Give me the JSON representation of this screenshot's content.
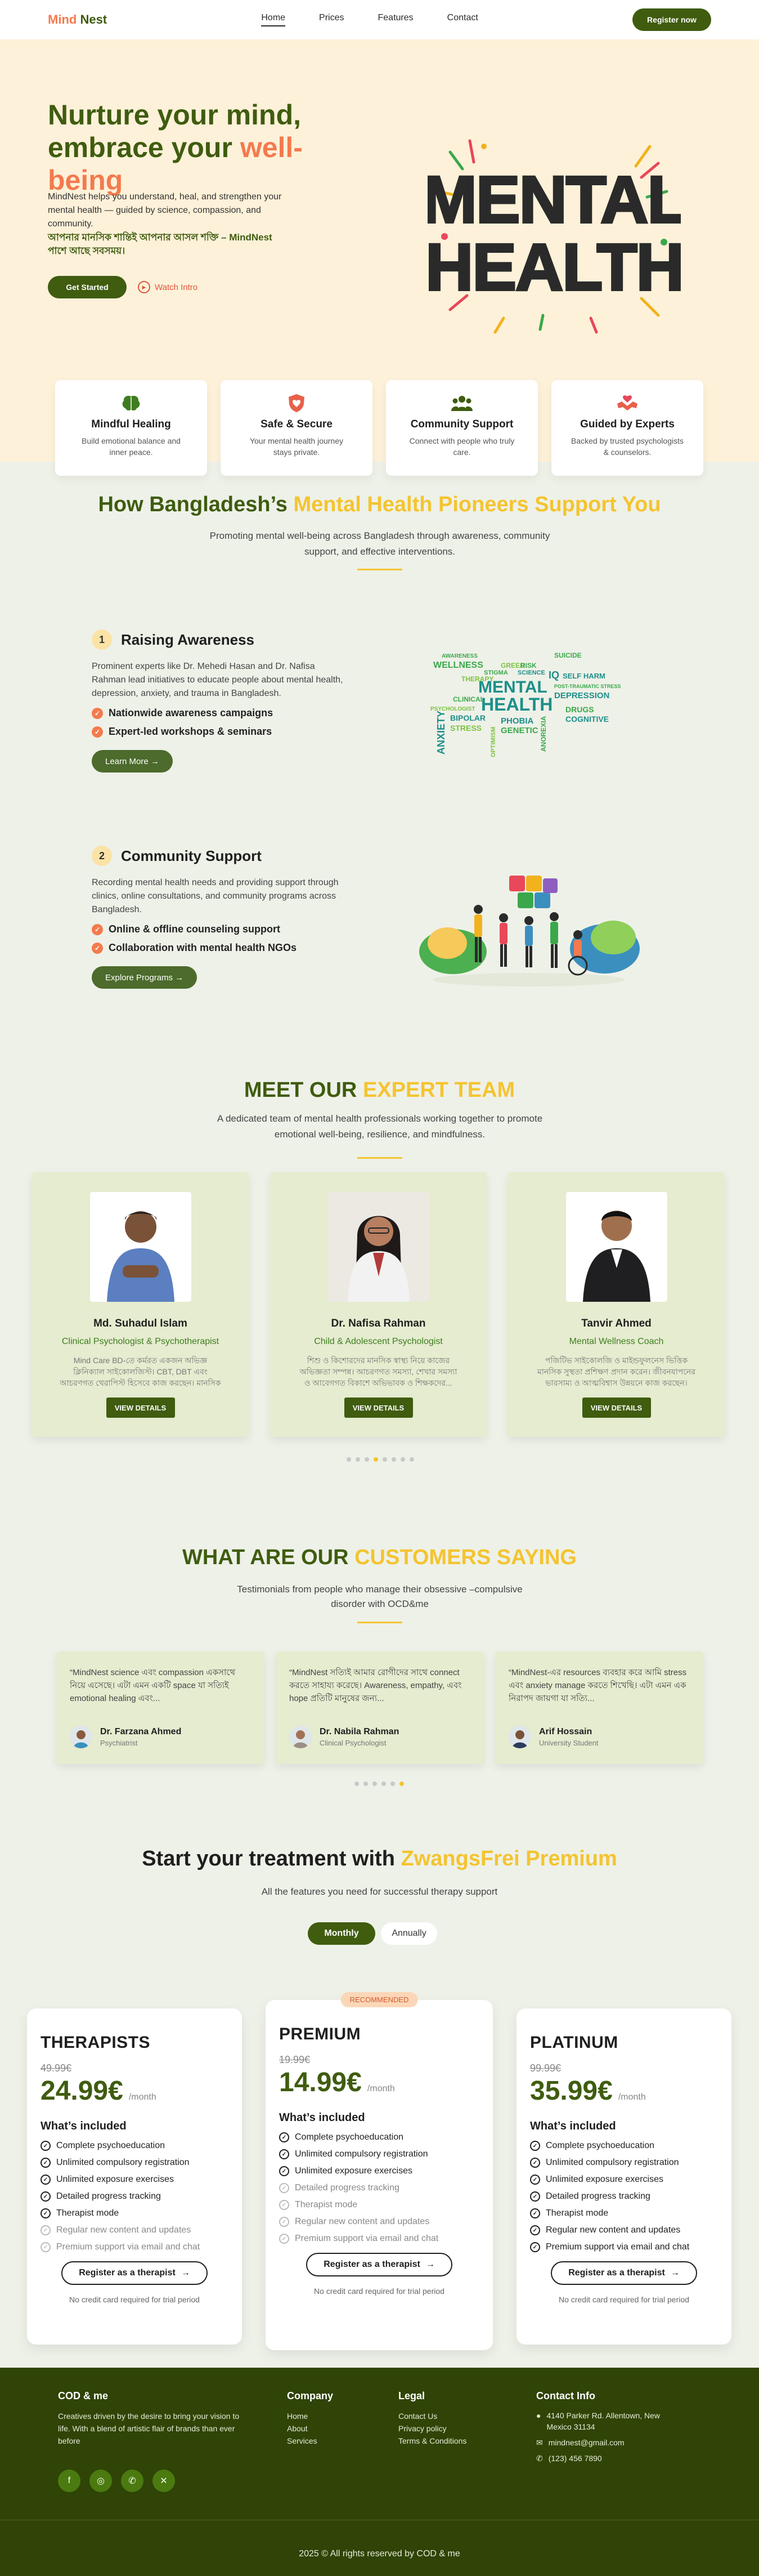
{
  "nav": {
    "brand_part1": "Mind",
    "brand_part2": "Nest",
    "links": [
      "Home",
      "Prices",
      "Features",
      "Contact"
    ],
    "register": "Register now"
  },
  "hero": {
    "title_line1": "Nurture your mind,",
    "title_line2": "embrace your",
    "title_accent1": "well-",
    "title_accent2": "being",
    "desc": "MindNest helps you understand, heal, and strengthen your mental health — guided by science, compassion, and community.",
    "bangla": "আপনার মানসিক শান্তিই আপনার আসল শক্তি – MindNest পাশে আছে সবসময়।",
    "start": "Get Started",
    "intro": "Watch Intro",
    "art_line1": "MENTAL",
    "art_line2": "HEALTH"
  },
  "features": [
    {
      "title": "Mindful Healing",
      "desc": "Build emotional balance and inner peace.",
      "icon": "brain-icon"
    },
    {
      "title": "Safe & Secure",
      "desc": "Your mental health journey stays private.",
      "icon": "shield-heart-icon"
    },
    {
      "title": "Community Support",
      "desc": "Connect with people who truly care.",
      "icon": "people-icon"
    },
    {
      "title": "Guided by Experts",
      "desc": "Backed by trusted psychologists & counselors.",
      "icon": "handshake-heart-icon"
    }
  ],
  "pioneers": {
    "title": "How Bangladesh’s",
    "title_accent": "Mental Health Pioneers Support You",
    "subtitle": "Promoting mental well-being across Bangladesh through awareness, community support, and effective interventions.",
    "step1": {
      "num": "1",
      "title": "Raising Awareness",
      "desc": "Prominent experts like Dr. Mehedi Hasan and Dr. Nafisa Rahman lead initiatives to educate people about mental health, depression, anxiety, and trauma in Bangladesh.",
      "bullets": [
        "Nationwide awareness campaigns",
        "Expert-led workshops & seminars"
      ],
      "button": "Learn More →"
    },
    "step2": {
      "num": "2",
      "title": "Community Support",
      "desc": "Recording mental health needs and providing support through clinics, online consultations, and community programs across Bangladesh.",
      "bullets": [
        "Online & offline counseling support",
        "Collaboration with mental health NGOs"
      ],
      "button": "Explore Programs →"
    },
    "wordcloud": [
      "AWARENESS",
      "WELLNESS",
      "ANXIETY",
      "MENTAL",
      "HEALTH",
      "THERAPY",
      "DEPRESSION",
      "SUICIDE",
      "BIPOLAR",
      "STRESS",
      "PHOBIA",
      "GENETIC",
      "DRUGS",
      "COGNITIVE",
      "PSYCHOLOGIST",
      "SELF HARM",
      "POST-TRAUMATIC STRESS",
      "CLINICAL",
      "IQ",
      "ANOREXIA",
      "GREED",
      "RISK",
      "STIGMA",
      "SCIENCE",
      "OPTIMISM"
    ]
  },
  "team": {
    "title": "MEET OUR",
    "title_accent": "EXPERT TEAM",
    "subtitle": "A dedicated team of mental health professionals working together to promote emotional well-being, resilience, and mindfulness.",
    "members": [
      {
        "name": "Md. Suhadul Islam",
        "role": "Clinical Psychologist & Psychotherapist",
        "bio": "Mind Care BD-তে কর্মরত একজন অভিজ্ঞ ক্লিনিক্যাল সাইকোলজিস্ট। CBT, DBT এবং আচরণগত থেরাপিস্ট হিসেবে কাজ করছেন। মানসিক চিকিৎসা ও আত্মবিশ্বাস...",
        "button": "VIEW DETAILS",
        "shirt": "#5b7fc0"
      },
      {
        "name": "Dr. Nafisa Rahman",
        "role": "Child & Adolescent Psychologist",
        "bio": "শিশু ও কিশোরদের মানসিক স্বাস্থ্য নিয়ে কাজের অভিজ্ঞতা সম্পন্ন। আচরণগত সমস্যা, শেখার সমস্যা ও আবেগগত বিকাশে অভিভাবক ও শিক্ষকদের...",
        "button": "VIEW DETAILS",
        "shirt": "#f2f2f2"
      },
      {
        "name": "Tanvir Ahmed",
        "role": "Mental Wellness Coach",
        "bio": "পজিটিভ সাইকোলজি ও মাইন্ডফুলনেস ভিত্তিক মানসিক সুস্থতা প্রশিক্ষণ প্রদান করেন। জীবনযাপনের ভারসাম্য ও আত্মবিশ্বাস উন্নয়নে কাজ করছেন।",
        "button": "VIEW DETAILS",
        "shirt": "#1f1f22"
      }
    ],
    "dots_total": 8,
    "dots_active": 3
  },
  "testimonials": {
    "title": "WHAT ARE OUR",
    "title_accent": "CUSTOMERS SAYING",
    "subtitle": "Testimonials from people who manage their obsessive –compulsive disorder with OCD&me",
    "items": [
      {
        "quote": "“MindNest science এবং compassion একসাথে নিয়ে এসেছে। এটা এমন একটি space যা সত্যিই emotional healing এবং...",
        "name": "Dr. Farzana Ahmed",
        "role": "Psychiatrist"
      },
      {
        "quote": "“MindNest সত্যিই আমার রোগীদের সাথে connect করতে সাহায্য করেছে। Awareness, empathy, এবং hope প্রতিটি মানুষের জন্য...",
        "name": "Dr. Nabila Rahman",
        "role": "Clinical Psychologist"
      },
      {
        "quote": "“MindNest-এর resources ব্যবহার করে আমি stress এবং anxiety manage করতে শিখেছি। এটা এমন এক নিরাপদ জায়গা যা সত্যি...",
        "name": "Arif Hossain",
        "role": "University Student"
      }
    ],
    "dots_total": 6,
    "dots_active": 5
  },
  "pricing": {
    "title": "Start your treatment with",
    "title_accent": "ZwangsFrei Premium",
    "subtitle": "All the features you need for successful therapy support",
    "toggle_on": "Monthly",
    "toggle_off": "Annually",
    "recommended": "RECOMMENDED",
    "per": "/month",
    "included": "What’s included",
    "note": "No credit card required for trial period",
    "plans": [
      {
        "name": "THERAPISTS",
        "old": "49.99€",
        "price": "24.99€",
        "cta": "Register as a therapist",
        "features": [
          {
            "t": "Complete psychoeducation",
            "on": true
          },
          {
            "t": "Unlimited compulsory registration",
            "on": true
          },
          {
            "t": "Unlimited exposure exercises",
            "on": true
          },
          {
            "t": "Detailed progress tracking",
            "on": true
          },
          {
            "t": "Therapist mode",
            "on": true
          },
          {
            "t": "Regular new content and updates",
            "on": false
          },
          {
            "t": "Premium support via email and chat",
            "on": false
          }
        ]
      },
      {
        "name": "PREMIUM",
        "old": "19.99€",
        "price": "14.99€",
        "cta": "Register as a therapist",
        "features": [
          {
            "t": "Complete psychoeducation",
            "on": true
          },
          {
            "t": "Unlimited compulsory registration",
            "on": true
          },
          {
            "t": "Unlimited exposure exercises",
            "on": true
          },
          {
            "t": "Detailed progress tracking",
            "on": false
          },
          {
            "t": "Therapist mode",
            "on": false
          },
          {
            "t": "Regular new content and updates",
            "on": false
          },
          {
            "t": "Premium support via email and chat",
            "on": false
          }
        ]
      },
      {
        "name": "PLATINUM",
        "old": "99.99€",
        "price": "35.99€",
        "cta": "Register as a therapist",
        "features": [
          {
            "t": "Complete psychoeducation",
            "on": true
          },
          {
            "t": "Unlimited compulsory registration",
            "on": true
          },
          {
            "t": "Unlimited exposure exercises",
            "on": true
          },
          {
            "t": "Detailed progress tracking",
            "on": true
          },
          {
            "t": "Therapist mode",
            "on": true
          },
          {
            "t": "Regular new content and updates",
            "on": true
          },
          {
            "t": "Premium support via email and chat",
            "on": true
          }
        ]
      }
    ]
  },
  "footer": {
    "brand": "COD & me",
    "tagline": "Creatives driven by the desire to bring your vision to life. With a blend of artistic flair of brands than ever before",
    "company_title": "Company",
    "company_links": [
      "Home",
      "About",
      "Services"
    ],
    "legal_title": "Legal",
    "legal_links": [
      "Contact Us",
      "Privacy policy",
      "Terms & Conditions"
    ],
    "contact_title": "Contact Info",
    "address": "4140 Parker Rd. Allentown, New Mexico 31134",
    "email": "mindnest@gmail.com",
    "phone": "(123) 456 7890",
    "social_icons": [
      "facebook-icon",
      "instagram-icon",
      "whatsapp-icon",
      "x-icon"
    ],
    "copyright": "2025 © All rights reserved by COD & me"
  },
  "colors": {
    "primary_green": "#3f5c0f",
    "accent_orange": "#f47a4e",
    "accent_yellow": "#f4c430",
    "hero_bg": "#fdf1d9",
    "footer_bg": "#2f4406"
  }
}
